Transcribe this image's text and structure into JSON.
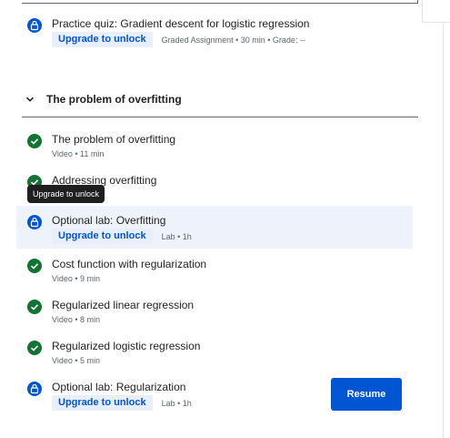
{
  "quiz": {
    "title": "Practice quiz: Gradient descent for logistic regression",
    "upgrade_label": "Upgrade to unlock",
    "meta": "Graded Assignment • 30 min • Grade: --"
  },
  "section": {
    "title": "The problem of overfitting",
    "chevron_icon": "chevron-down-icon"
  },
  "items": [
    {
      "title": "The problem of overfitting",
      "meta": "Video • 11 min",
      "status": "completed"
    },
    {
      "title": "Addressing overfitting",
      "meta": "",
      "status": "completed"
    },
    {
      "title": "Optional lab: Overfitting",
      "upgrade_label": "Upgrade to unlock",
      "meta": "Lab • 1h",
      "status": "locked"
    },
    {
      "title": "Cost function with regularization",
      "meta": "Video • 9 min",
      "status": "completed"
    },
    {
      "title": "Regularized linear regression",
      "meta": "Video • 8 min",
      "status": "completed"
    },
    {
      "title": "Regularized logistic regression",
      "meta": "Video • 5 min",
      "status": "completed"
    },
    {
      "title": "Optional lab: Regularization",
      "upgrade_label": "Upgrade to unlock",
      "meta": "Lab • 1h",
      "status": "locked"
    }
  ],
  "tooltip": {
    "text": "Upgrade to unlock"
  },
  "resume_button": {
    "label": "Resume"
  },
  "colors": {
    "accent": "#0056d2",
    "success": "#137333",
    "highlight": "#eef3fb"
  }
}
